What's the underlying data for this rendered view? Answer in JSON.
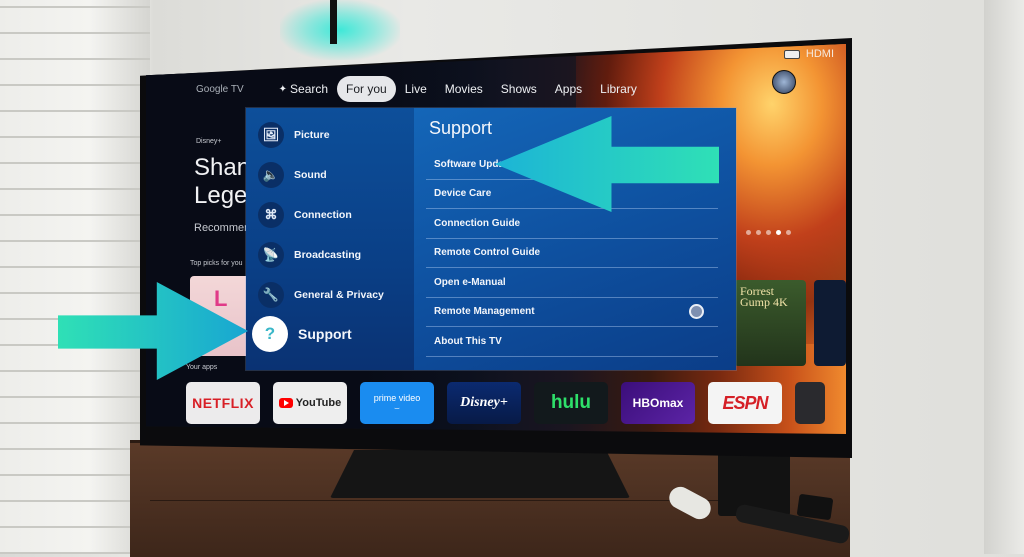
{
  "tv": {
    "brand_label": "Google TV",
    "nav_tabs": [
      {
        "label": "Search",
        "icon": "search-icon"
      },
      {
        "label": "For you",
        "active": true
      },
      {
        "label": "Live"
      },
      {
        "label": "Movies"
      },
      {
        "label": "Shows"
      },
      {
        "label": "Apps"
      },
      {
        "label": "Library"
      }
    ],
    "input_source": "HDMI",
    "hero": {
      "provider": "Disney+",
      "title": "Shang-Chi and the\nLegend of the Ten Rings",
      "subtitle": "Recommended"
    },
    "sections": {
      "top_picks": "Top picks for you",
      "your_apps": "Your apps"
    },
    "side_card_title": "Forrest\nGump 4K",
    "apps": [
      "NETFLIX",
      "YouTube",
      "prime video",
      "Disney+",
      "hulu",
      "HBOmax",
      "ESPN",
      ""
    ],
    "carousel": {
      "count": 5,
      "active_index": 3
    }
  },
  "settings": {
    "menu": [
      {
        "label": "Picture",
        "icon": "picture-icon",
        "glyph": "🖼"
      },
      {
        "label": "Sound",
        "icon": "speaker-icon",
        "glyph": "🔈"
      },
      {
        "label": "Connection",
        "icon": "network-icon",
        "glyph": "⌘"
      },
      {
        "label": "Broadcasting",
        "icon": "satellite-dish-icon",
        "glyph": "📡"
      },
      {
        "label": "General & Privacy",
        "icon": "wrench-icon",
        "glyph": "🔧"
      },
      {
        "label": "Support",
        "icon": "help-cloud-icon",
        "glyph": "?",
        "selected": true
      }
    ],
    "submenu_title": "Support",
    "submenu": [
      {
        "label": "Software Update"
      },
      {
        "label": "Device Care"
      },
      {
        "label": "Connection Guide"
      },
      {
        "label": "Remote Control Guide"
      },
      {
        "label": "Open e-Manual"
      },
      {
        "label": "Remote Management",
        "toggle": "off"
      },
      {
        "label": "About This TV"
      }
    ]
  },
  "colors": {
    "annotation_arrow": "#22c7c9",
    "menu_blue": "#0e4f9e",
    "active_tab": "#e6e7ea"
  }
}
